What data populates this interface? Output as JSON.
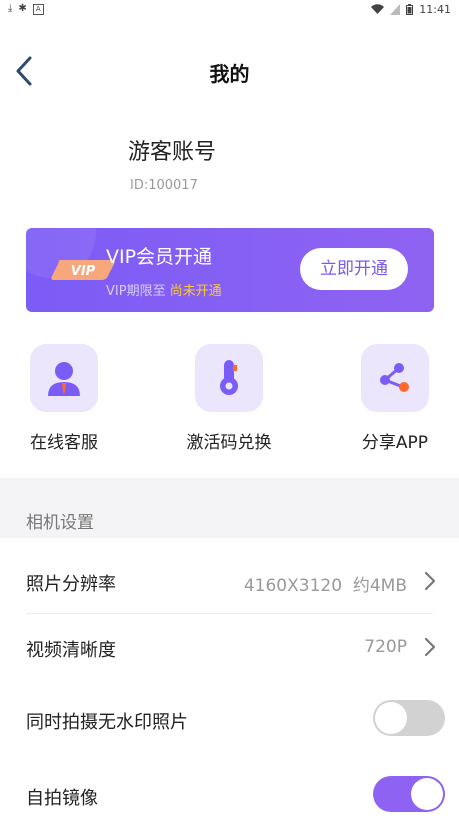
{
  "status_bar": {
    "time": "11:41",
    "left_icons": [
      "download-icon",
      "bug-icon",
      "a-icon"
    ],
    "right_icons": [
      "wifi-icon",
      "signal-icon",
      "battery-icon"
    ]
  },
  "header": {
    "title": "我的"
  },
  "profile": {
    "name": "游客账号",
    "id": "ID:100017"
  },
  "vip": {
    "badge": "VIP",
    "title": "VIP会员开通",
    "expiry_label": "VIP期限至",
    "expiry_value": "尚未开通",
    "button": "立即开通",
    "colors": {
      "card": "#7c5cf6",
      "highlight": "#ffc93a",
      "badge": "#f6a77c"
    }
  },
  "quick_actions": [
    {
      "label": "在线客服",
      "icon": "customer-service-icon"
    },
    {
      "label": "激活码兑换",
      "icon": "key-icon"
    },
    {
      "label": "分享APP",
      "icon": "share-icon"
    }
  ],
  "camera_settings": {
    "section_title": "相机设置",
    "rows": [
      {
        "label": "照片分辨率",
        "value": "4160X3120  约4MB"
      },
      {
        "label": "视频清晰度",
        "value": "720P"
      },
      {
        "label": "同时拍摄无水印照片",
        "toggle": false
      },
      {
        "label": "自拍镜像",
        "toggle": true
      }
    ]
  },
  "colors": {
    "accent": "#8e63f3",
    "icon_bg": "#ebe6fb",
    "orange": "#ff6a2b"
  }
}
